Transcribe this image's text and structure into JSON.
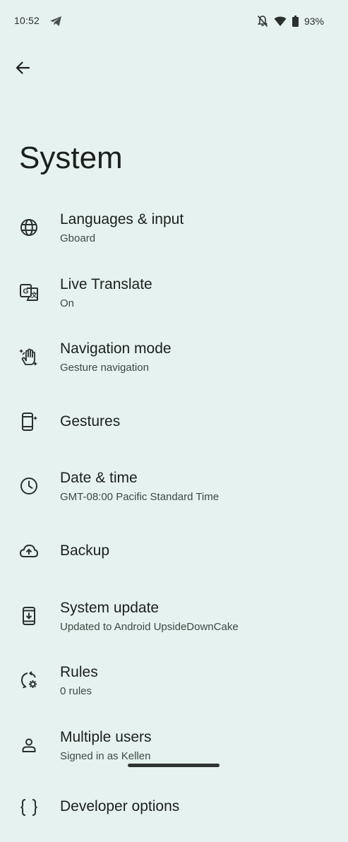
{
  "status_bar": {
    "time": "10:52",
    "battery": "93%",
    "icons": [
      "telegram-icon",
      "notifications-off-icon",
      "wifi-icon",
      "battery-icon"
    ]
  },
  "header": {
    "back_icon": "arrow-back-icon",
    "title": "System"
  },
  "items": [
    {
      "icon": "globe-icon",
      "title": "Languages & input",
      "subtitle": "Gboard"
    },
    {
      "icon": "translate-icon",
      "title": "Live Translate",
      "subtitle": "On"
    },
    {
      "icon": "gesture-hand-icon",
      "title": "Navigation mode",
      "subtitle": "Gesture navigation"
    },
    {
      "icon": "phone-gesture-icon",
      "title": "Gestures",
      "subtitle": ""
    },
    {
      "icon": "clock-icon",
      "title": "Date & time",
      "subtitle": "GMT-08:00 Pacific Standard Time"
    },
    {
      "icon": "cloud-upload-icon",
      "title": "Backup",
      "subtitle": ""
    },
    {
      "icon": "system-update-icon",
      "title": "System update",
      "subtitle": "Updated to Android UpsideDownCake"
    },
    {
      "icon": "rules-icon",
      "title": "Rules",
      "subtitle": "0 rules"
    },
    {
      "icon": "person-icon",
      "title": "Multiple users",
      "subtitle": "Signed in as Kellen"
    },
    {
      "icon": "code-braces-icon",
      "title": "Developer options",
      "subtitle": ""
    }
  ],
  "colors": {
    "background": "#e6f2ef",
    "text_primary": "#1b1f1e",
    "text_secondary": "#3f4946"
  }
}
